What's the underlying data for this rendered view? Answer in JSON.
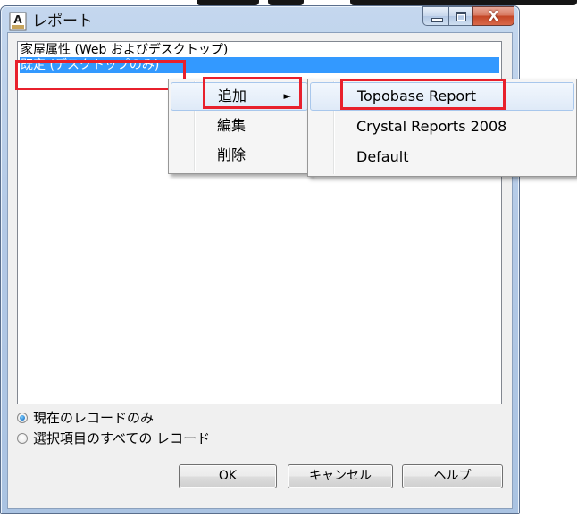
{
  "window": {
    "title": "レポート",
    "icon": "app-icon"
  },
  "caption_buttons": {
    "minimize_icon": "minimize-icon",
    "maximize_icon": "maximize-icon",
    "close_glyph": "X"
  },
  "listbox": {
    "items": [
      {
        "label": "家屋属性 (Web およびデスクトップ)",
        "selected": false
      },
      {
        "label": "既定 (デスクトップのみ)",
        "selected": true
      }
    ]
  },
  "context_menu": {
    "items": [
      {
        "label": "追加",
        "has_submenu": true,
        "highlighted": true
      },
      {
        "label": "編集"
      },
      {
        "label": "削除"
      }
    ],
    "submenu_arrow": "►"
  },
  "submenu": {
    "items": [
      {
        "label": "Topobase Report",
        "highlighted": true
      },
      {
        "label": "Crystal Reports 2008"
      },
      {
        "label": "Default"
      }
    ]
  },
  "options": {
    "radio": [
      {
        "label": "現在のレコードのみ",
        "checked": true
      },
      {
        "label": "選択項目のすべての レコード",
        "checked": false
      }
    ]
  },
  "buttons": {
    "ok": "OK",
    "cancel": "キャンセル",
    "help": "ヘルプ"
  },
  "colors": {
    "selection": "#3399ff",
    "highlight_annotation": "#e8202c",
    "close_button": "#c44626"
  }
}
